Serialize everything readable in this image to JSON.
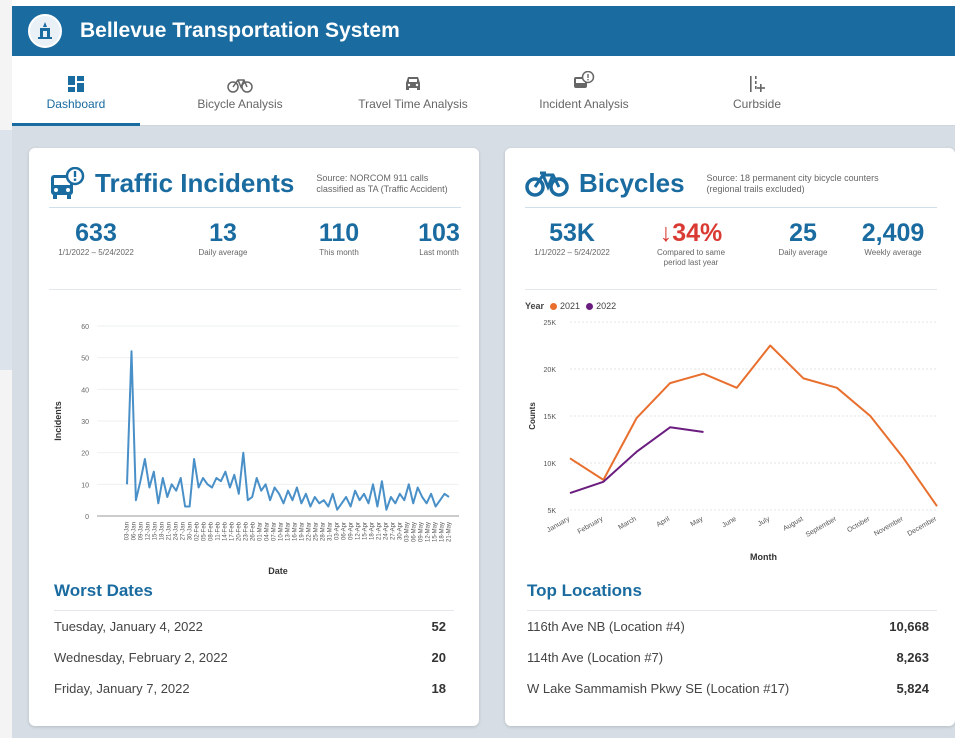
{
  "app": {
    "title": "Bellevue Transportation System"
  },
  "tabs": [
    {
      "label": "Dashboard",
      "icon": "dashboard-icon",
      "active": true
    },
    {
      "label": "Bicycle Analysis",
      "icon": "bicycle-icon",
      "active": false
    },
    {
      "label": "Travel Time Analysis",
      "icon": "car-icon",
      "active": false
    },
    {
      "label": "Incident Analysis",
      "icon": "incident-icon",
      "active": false
    },
    {
      "label": "Curbside",
      "icon": "curbside-icon",
      "active": false
    }
  ],
  "incidents": {
    "title": "Traffic Incidents",
    "source": "Source: NORCOM 911 calls classified as TA (Traffic Accident)",
    "kpis": [
      {
        "value": "633",
        "label": "1/1/2022 – 5/24/2022"
      },
      {
        "value": "13",
        "label": "Daily average"
      },
      {
        "value": "110",
        "label": "This month"
      },
      {
        "value": "103",
        "label": "Last month"
      }
    ],
    "worst_title": "Worst Dates",
    "worst": [
      {
        "date": "Tuesday, January 4, 2022",
        "value": "52"
      },
      {
        "date": "Wednesday, February 2, 2022",
        "value": "20"
      },
      {
        "date": "Friday, January 7, 2022",
        "value": "18"
      }
    ]
  },
  "bicycles": {
    "title": "Bicycles",
    "source": "Source: 18 permanent city bicycle counters (regional trails excluded)",
    "kpis": [
      {
        "value": "53K",
        "label": "1/1/2022 – 5/24/2022"
      },
      {
        "value": "↓34%",
        "label": "Compared to same period last year"
      },
      {
        "value": "25",
        "label": "Daily average"
      },
      {
        "value": "2,409",
        "label": "Weekly average"
      }
    ],
    "legend_title": "Year",
    "top_title": "Top Locations",
    "top": [
      {
        "name": "116th Ave NB (Location #4)",
        "value": "10,668"
      },
      {
        "name": "114th Ave (Location #7)",
        "value": "8,263"
      },
      {
        "name": "W Lake Sammamish Pkwy SE (Location #17)",
        "value": "5,824"
      }
    ]
  },
  "colors": {
    "primary": "#1a6ba0",
    "series2021": "#e86f2e",
    "series2022": "#6b1d7f",
    "incident_line": "#4a90c8",
    "negative": "#d93a33"
  },
  "chart_data": [
    {
      "type": "line",
      "xlabel": "Date",
      "ylabel": "Incidents",
      "ylim": [
        0,
        60
      ],
      "yticks": [
        0,
        10,
        20,
        30,
        40,
        50,
        60
      ],
      "grid": true,
      "x_tick_labels": [
        "03-Jan",
        "06-Jan",
        "09-Jan",
        "12-Jan",
        "15-Jan",
        "18-Jan",
        "21-Jan",
        "24-Jan",
        "27-Jan",
        "30-Jan",
        "02-Feb",
        "05-Feb",
        "08-Feb",
        "11-Feb",
        "14-Feb",
        "17-Feb",
        "20-Feb",
        "23-Feb",
        "26-Feb",
        "01-Mar",
        "04-Mar",
        "07-Mar",
        "10-Mar",
        "13-Mar",
        "16-Mar",
        "19-Mar",
        "22-Mar",
        "25-Mar",
        "28-Mar",
        "31-Mar",
        "03-Apr",
        "06-Apr",
        "09-Apr",
        "12-Apr",
        "15-Apr",
        "18-Apr",
        "21-Apr",
        "24-Apr",
        "27-Apr",
        "30-Apr",
        "03-May",
        "06-May",
        "09-May",
        "12-May",
        "15-May",
        "18-May",
        "21-May"
      ],
      "series": [
        {
          "values": [
            10,
            52,
            5,
            11,
            18,
            9,
            14,
            4,
            12,
            6,
            10,
            8,
            12,
            3,
            3,
            18,
            9,
            12,
            10,
            9,
            12,
            11,
            14,
            9,
            13,
            7,
            20,
            5,
            6,
            12,
            8,
            10,
            5,
            9,
            7,
            4,
            8,
            5,
            9,
            4,
            7,
            3,
            6,
            4,
            5,
            3,
            7,
            2,
            4,
            6,
            3,
            8,
            5,
            7,
            4,
            10,
            3,
            11,
            2,
            6,
            4,
            7,
            5,
            10,
            4,
            9,
            6,
            4,
            7,
            3,
            5,
            7,
            6
          ]
        }
      ]
    },
    {
      "type": "line",
      "xlabel": "Month",
      "ylabel": "Counts",
      "ylim": [
        5000,
        25000
      ],
      "yticks": [
        "5K",
        "10K",
        "15K",
        "20K",
        "25K"
      ],
      "grid": true,
      "legend": "top-left",
      "categories": [
        "January",
        "February",
        "March",
        "April",
        "May",
        "June",
        "July",
        "August",
        "September",
        "October",
        "November",
        "December"
      ],
      "series": [
        {
          "name": "2021",
          "values": [
            10500,
            8200,
            14800,
            18500,
            19500,
            18000,
            22500,
            19000,
            18000,
            15000,
            10500,
            5400
          ]
        },
        {
          "name": "2022",
          "values": [
            6800,
            8000,
            11200,
            13800,
            13300
          ]
        }
      ]
    }
  ]
}
